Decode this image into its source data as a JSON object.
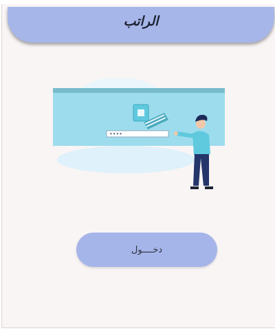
{
  "header": {
    "title": "الراتب"
  },
  "illustration": {
    "password_dots": "••••"
  },
  "login": {
    "label": "دخــــول"
  },
  "colors": {
    "header": "#a7b6e8",
    "button": "#a6b5e9",
    "background": "#f9f5f5",
    "accent": "#5fc9de"
  }
}
